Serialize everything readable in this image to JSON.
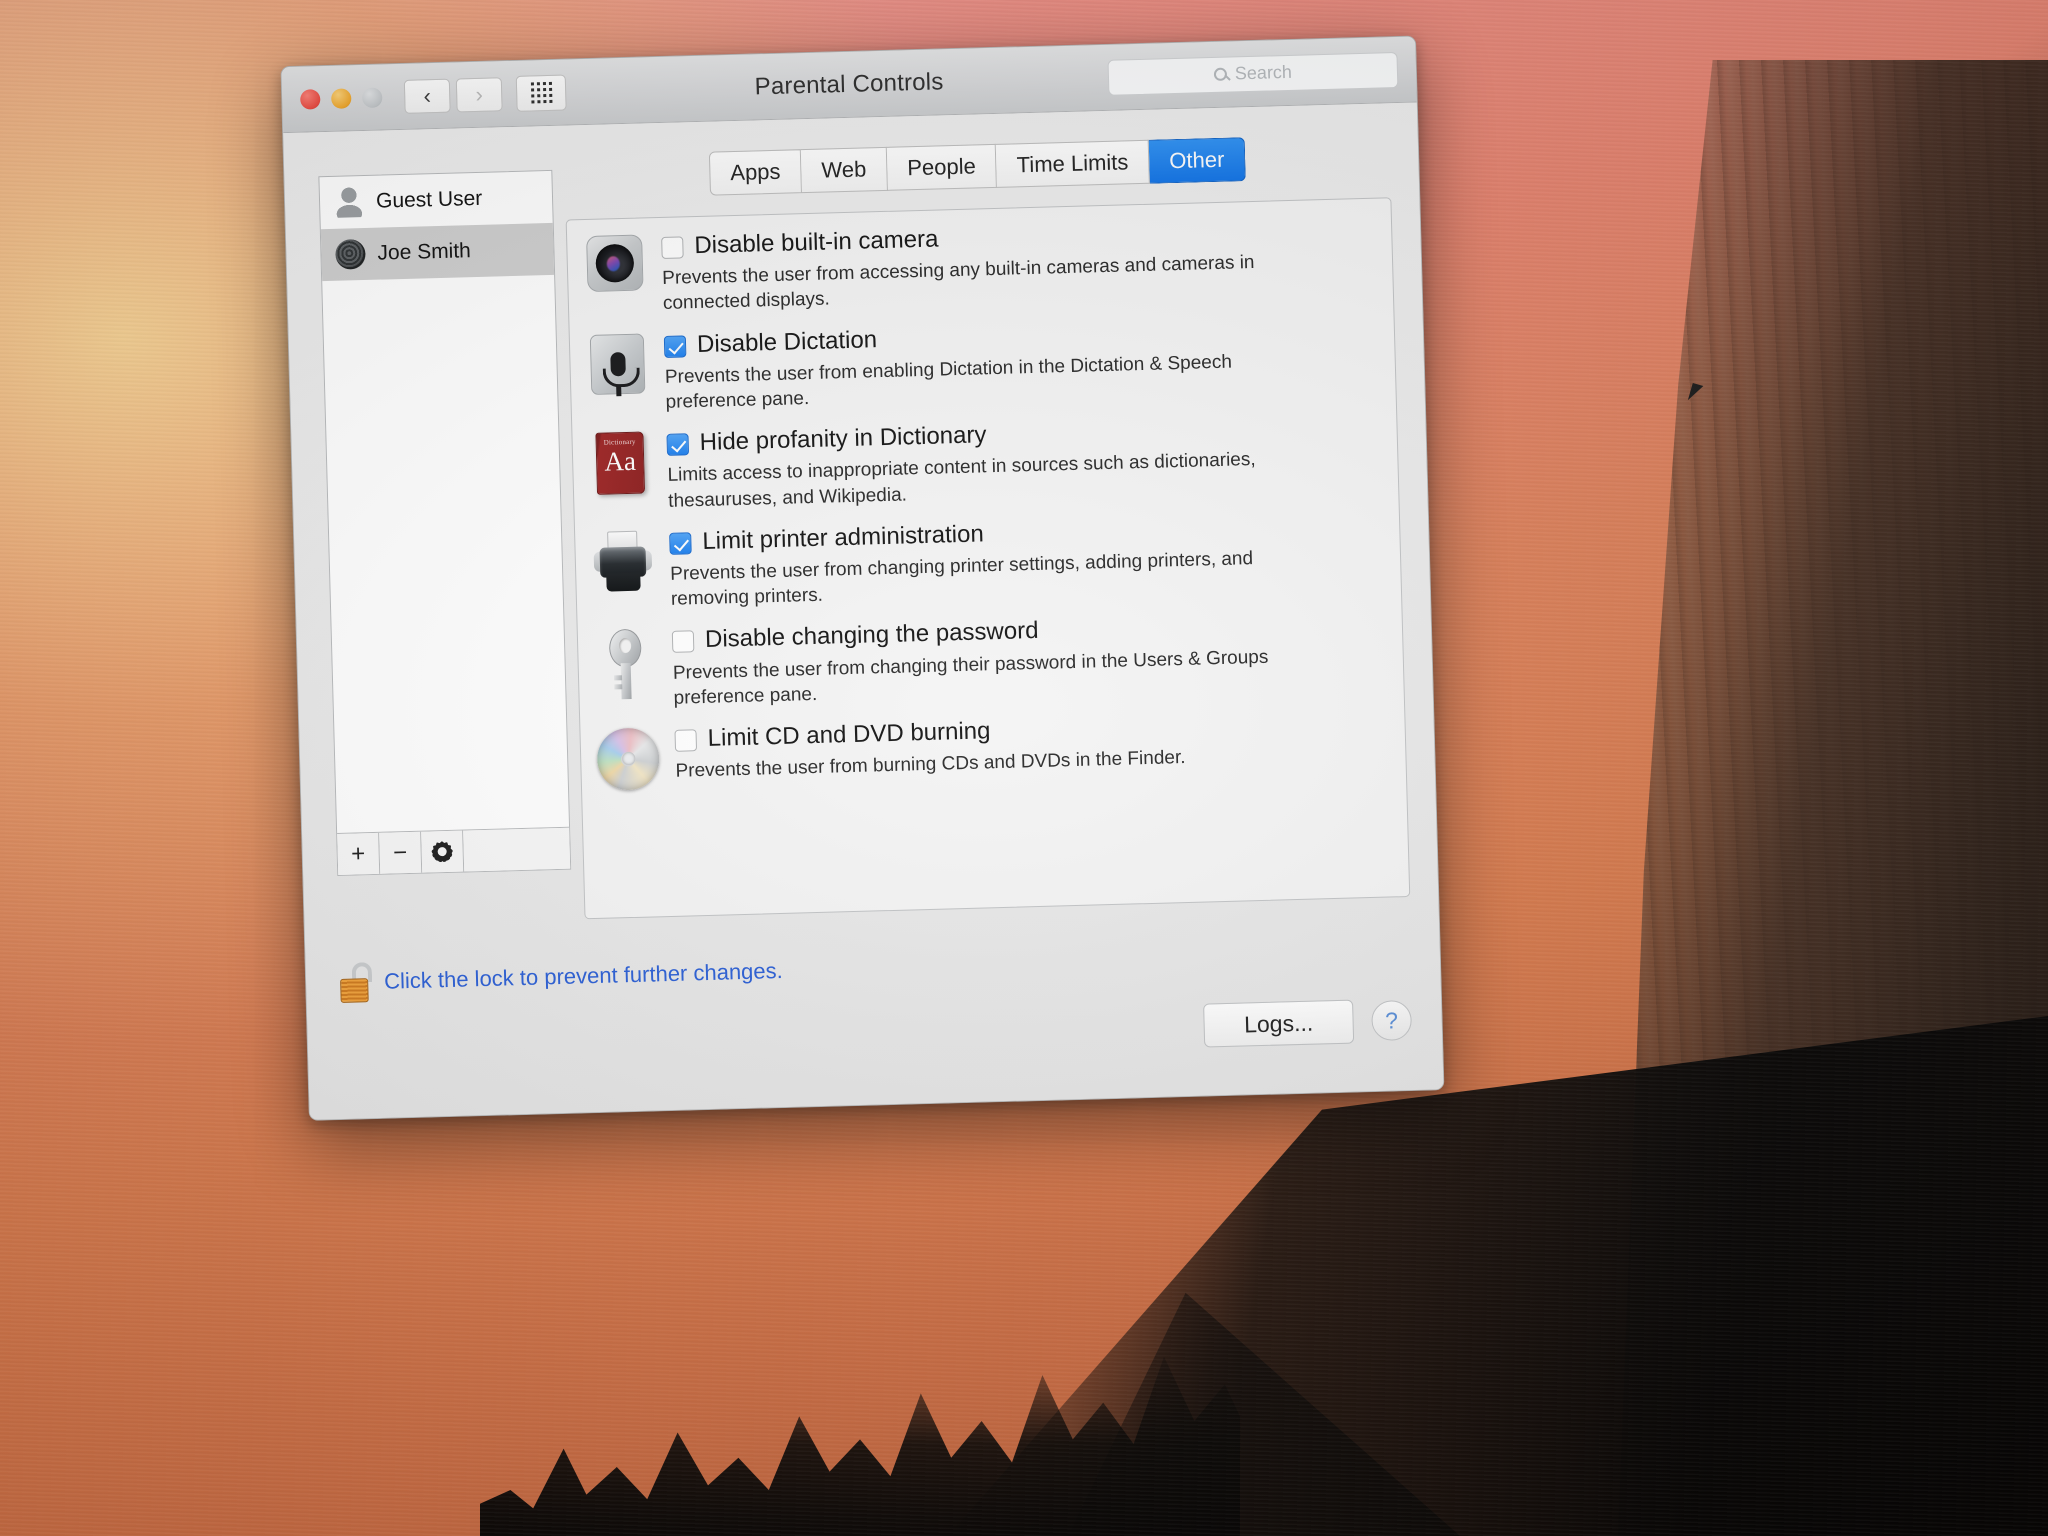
{
  "window": {
    "title": "Parental Controls",
    "traffic": {
      "close": "close-button",
      "minimize": "minimize-button",
      "zoom": "zoom-button"
    },
    "nav": {
      "back": "‹",
      "forward": "›",
      "show_all": "show-all-grid"
    },
    "search": {
      "placeholder": "Search",
      "value": ""
    }
  },
  "sidebar": {
    "users": [
      {
        "name": "Guest User",
        "icon": "guest-user-icon",
        "selected": false
      },
      {
        "name": "Joe Smith",
        "icon": "user-avatar-icon",
        "selected": true
      }
    ],
    "tools": {
      "add": "+",
      "remove": "−",
      "action": "gear-icon"
    }
  },
  "tabs": [
    {
      "label": "Apps",
      "active": false
    },
    {
      "label": "Web",
      "active": false
    },
    {
      "label": "People",
      "active": false
    },
    {
      "label": "Time Limits",
      "active": false
    },
    {
      "label": "Other",
      "active": true
    }
  ],
  "options": [
    {
      "icon": "camera-icon",
      "checked": false,
      "label": "Disable built-in camera",
      "description": "Prevents the user from accessing any built-in cameras and cameras in connected displays."
    },
    {
      "icon": "microphone-icon",
      "checked": true,
      "label": "Disable Dictation",
      "description": "Prevents the user from enabling Dictation in the Dictation & Speech preference pane."
    },
    {
      "icon": "dictionary-icon",
      "checked": true,
      "label": "Hide profanity in Dictionary",
      "description": "Limits access to inappropriate content in sources such as dictionaries, thesauruses, and Wikipedia."
    },
    {
      "icon": "printer-icon",
      "checked": true,
      "label": "Limit printer administration",
      "description": "Prevents the user from changing printer settings, adding printers, and removing printers."
    },
    {
      "icon": "key-icon",
      "checked": false,
      "label": "Disable changing the password",
      "description": "Prevents the user from changing their password in the Users & Groups preference pane."
    },
    {
      "icon": "cd-disc-icon",
      "checked": false,
      "label": "Limit CD and DVD burning",
      "description": "Prevents the user from burning CDs and DVDs in the Finder."
    }
  ],
  "dictionary_icon": {
    "title": "Dictionary",
    "glyph": "Aa"
  },
  "footer": {
    "lock_icon": "unlocked-padlock-icon",
    "lock_text": "Click the lock to prevent further changes.",
    "logs_label": "Logs...",
    "help_label": "?"
  },
  "colors": {
    "accent_blue": "#1d80ef",
    "link_blue": "#2b5fd6",
    "selected_tab": "#1174e8",
    "sidebar_selected": "#cfcfcf"
  }
}
